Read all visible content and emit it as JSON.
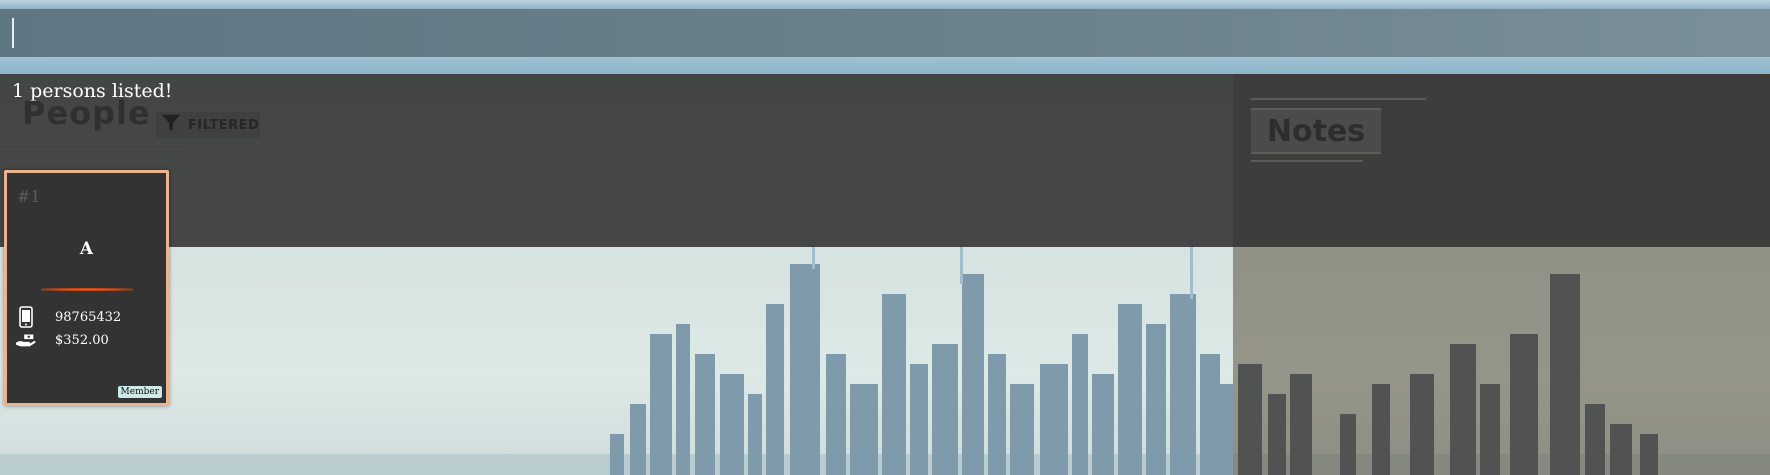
{
  "command_box": {
    "value": ""
  },
  "result_display": {
    "text": "1 persons listed!"
  },
  "people_panel": {
    "title": "People",
    "filter_chip": {
      "icon": "filter-icon",
      "label": "FILTERED"
    }
  },
  "notes_panel": {
    "title": "Notes"
  },
  "persons": [
    {
      "index": "#1",
      "name": "A",
      "phone": {
        "icon": "phone-icon",
        "value": "98765432"
      },
      "balance": {
        "icon": "hand-money-icon",
        "value": "$352.00"
      },
      "tags": [
        "Member"
      ]
    }
  ],
  "colors": {
    "card_border": "#e9b48f",
    "divider": "#d9480f",
    "tag_bg": "#cde9ea",
    "panel_bg": "#3a3a3a"
  }
}
